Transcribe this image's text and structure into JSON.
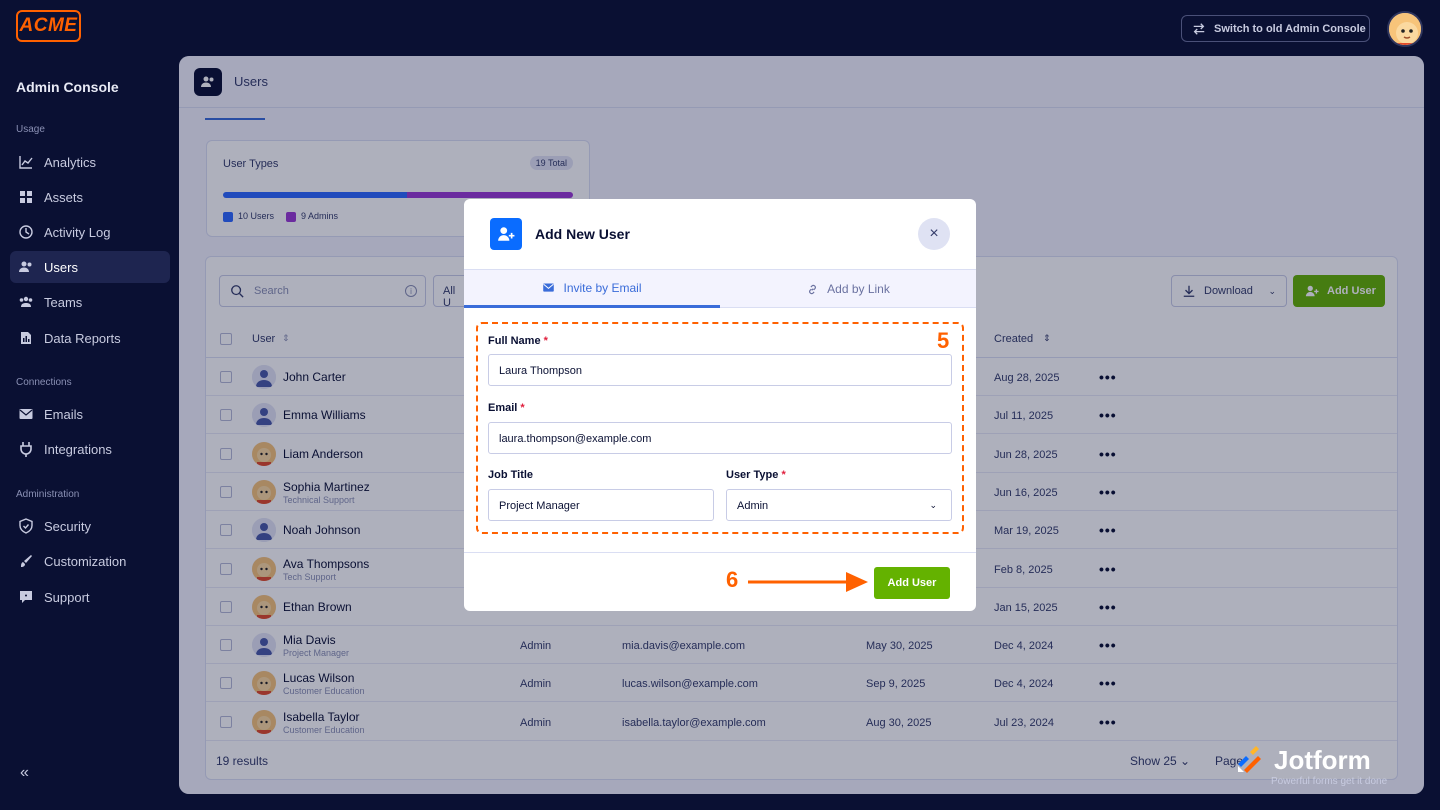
{
  "topbar": {
    "logo": "ACME",
    "switch_label": "Switch to old Admin Console"
  },
  "sidebar": {
    "title": "Admin Console",
    "sections": [
      {
        "label": "Usage"
      },
      {
        "label": "Connections"
      },
      {
        "label": "Administration"
      }
    ],
    "items": [
      {
        "label": "Analytics",
        "icon": "chart-icon"
      },
      {
        "label": "Assets",
        "icon": "grid-icon"
      },
      {
        "label": "Activity Log",
        "icon": "clock-icon"
      },
      {
        "label": "Users",
        "icon": "users-icon",
        "active": true
      },
      {
        "label": "Teams",
        "icon": "team-icon"
      },
      {
        "label": "Data Reports",
        "icon": "report-icon"
      },
      {
        "label": "Emails",
        "icon": "mail-icon"
      },
      {
        "label": "Integrations",
        "icon": "plug-icon"
      },
      {
        "label": "Security",
        "icon": "shield-icon"
      },
      {
        "label": "Customization",
        "icon": "brush-icon"
      },
      {
        "label": "Support",
        "icon": "chat-icon"
      }
    ],
    "collapse": "«"
  },
  "page": {
    "title": "Users",
    "user_types": {
      "label": "User Types",
      "total": "19 Total",
      "users_legend": "10 Users",
      "admins_legend": "9 Admins",
      "users_count": 10,
      "admins_count": 9
    },
    "search_placeholder": "Search",
    "filter_label": "All U",
    "download_label": "Download",
    "add_user_label": "Add User",
    "columns": {
      "user": "User",
      "created": "Created"
    },
    "rows": [
      {
        "name": "John Carter",
        "subtitle": "",
        "role": "",
        "email": "",
        "last": "",
        "created": "Aug 28, 2025",
        "avatar": "person"
      },
      {
        "name": "Emma Williams",
        "subtitle": "",
        "role": "",
        "email": "",
        "last": "",
        "created": "Jul 11, 2025",
        "avatar": "person"
      },
      {
        "name": "Liam Anderson",
        "subtitle": "",
        "role": "",
        "email": "",
        "last": "",
        "created": "Jun 28, 2025",
        "avatar": "podo"
      },
      {
        "name": "Sophia Martinez",
        "subtitle": "Technical Support",
        "role": "",
        "email": "",
        "last": "",
        "created": "Jun 16, 2025",
        "avatar": "podo"
      },
      {
        "name": "Noah Johnson",
        "subtitle": "",
        "role": "",
        "email": "",
        "last": "",
        "created": "Mar 19, 2025",
        "avatar": "person"
      },
      {
        "name": "Ava Thompsons",
        "subtitle": "Tech Support",
        "role": "",
        "email": "",
        "last": "",
        "created": "Feb 8, 2025",
        "avatar": "podo"
      },
      {
        "name": "Ethan Brown",
        "subtitle": "",
        "role": "",
        "email": "",
        "last": "",
        "created": "Jan 15, 2025",
        "avatar": "podo"
      },
      {
        "name": "Mia Davis",
        "subtitle": "Project Manager",
        "role": "Admin",
        "email": "mia.davis@example.com",
        "last": "May 30, 2025",
        "created": "Dec 4, 2024",
        "avatar": "person"
      },
      {
        "name": "Lucas Wilson",
        "subtitle": "Customer Education",
        "role": "Admin",
        "email": "lucas.wilson@example.com",
        "last": "Sep 9, 2025",
        "created": "Dec 4, 2024",
        "avatar": "podo"
      },
      {
        "name": "Isabella Taylor",
        "subtitle": "Customer Education",
        "role": "Admin",
        "email": "isabella.taylor@example.com",
        "last": "Aug 30, 2025",
        "created": "Jul 23, 2024",
        "avatar": "podo"
      }
    ],
    "results": "19 results",
    "show": "Show 25",
    "page_label": "Page"
  },
  "modal": {
    "title": "Add New User",
    "tabs": [
      {
        "label": "Invite by Email",
        "active": true
      },
      {
        "label": "Add by Link",
        "active": false
      }
    ],
    "full_name_label": "Full Name",
    "full_name_value": "Laura Thompson",
    "email_label": "Email",
    "email_value": "laura.thompson@example.com",
    "job_title_label": "Job Title",
    "job_title_value": "Project Manager",
    "user_type_label": "User Type",
    "user_type_value": "Admin",
    "required_mark": "*",
    "submit_label": "Add User",
    "step_5": "5",
    "step_6": "6"
  },
  "watermark": {
    "brand": "Jotform",
    "tagline": "Powerful forms get it done"
  }
}
